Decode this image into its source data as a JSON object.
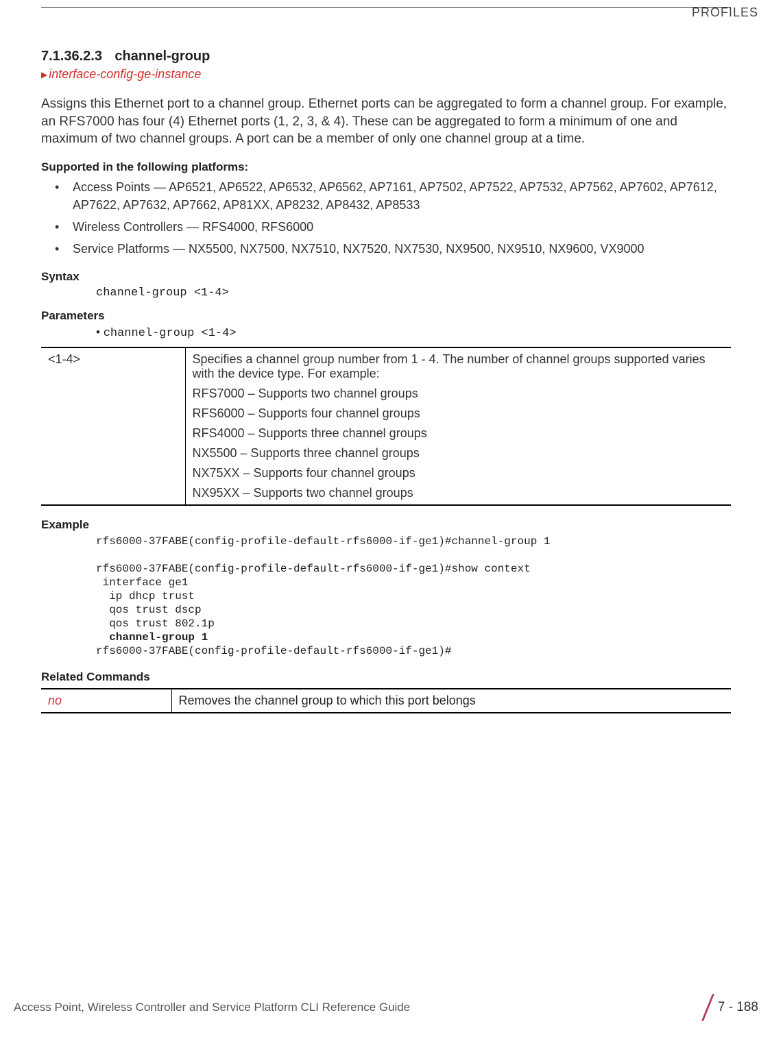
{
  "header": {
    "right": "PROFILES"
  },
  "section": {
    "number": "7.1.36.2.3",
    "title": "channel-group",
    "link": "interface-config-ge-instance"
  },
  "para": "Assigns this Ethernet port to a channel group. Ethernet ports can be aggregated to form a channel group. For example, an RFS7000 has four (4) Ethernet ports (1, 2, 3, & 4). These can be aggregated to form a minimum of one and maximum of two channel groups. A port can be a member of only one channel group at a time.",
  "platforms_heading": "Supported in the following platforms:",
  "platforms": [
    "Access Points — AP6521, AP6522, AP6532, AP6562, AP7161, AP7502, AP7522, AP7532, AP7562, AP7602, AP7612, AP7622, AP7632, AP7662, AP81XX, AP8232, AP8432, AP8533",
    "Wireless Controllers — RFS4000, RFS6000",
    "Service Platforms — NX5500, NX7500, NX7510, NX7520, NX7530, NX9500, NX9510, NX9600, VX9000"
  ],
  "syntax_heading": "Syntax",
  "syntax": "channel-group <1-4>",
  "parameters_heading": "Parameters",
  "param_bullet": "channel-group <1-4>",
  "param_table": {
    "key": "<1-4>",
    "intro": "Specifies a channel group number from 1 - 4. The number of channel groups supported varies with the device type. For example:",
    "rows": [
      "RFS7000 – Supports two channel groups",
      "RFS6000 – Supports four channel groups",
      "RFS4000 – Supports three channel groups",
      "NX5500 – Supports three channel groups",
      "NX75XX – Supports four channel groups",
      "NX95XX – Supports two channel groups"
    ]
  },
  "example_heading": "Example",
  "example": "rfs6000-37FABE(config-profile-default-rfs6000-if-ge1)#channel-group 1\n\nrfs6000-37FABE(config-profile-default-rfs6000-if-ge1)#show context\n interface ge1\n  ip dhcp trust\n  qos trust dscp\n  qos trust 802.1p\n  <b>channel-group 1</b>\nrfs6000-37FABE(config-profile-default-rfs6000-if-ge1)#",
  "related_heading": "Related Commands",
  "related": {
    "cmd": "no",
    "desc": "Removes the channel group to which this port belongs"
  },
  "footer": {
    "left": "Access Point, Wireless Controller and Service Platform CLI Reference Guide",
    "right": "7 - 188"
  }
}
